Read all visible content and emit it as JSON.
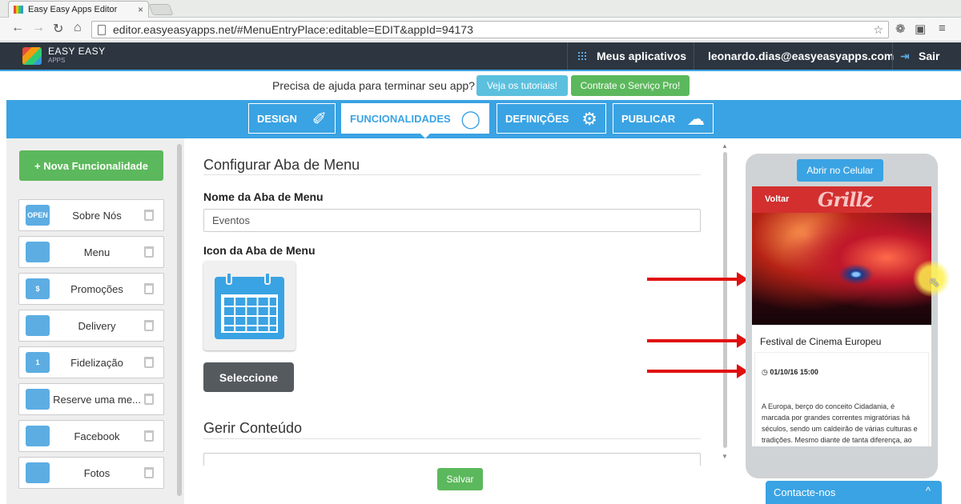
{
  "browser": {
    "tab_title": "Easy Easy Apps Editor",
    "tab_close": "×",
    "url": "editor.easyeasyapps.net/#MenuEntryPlace:editable=EDIT&appId=94173"
  },
  "header": {
    "brand_name": "EASY EASY",
    "brand_sub": "APPS",
    "my_apps": "Meus aplicativos",
    "user_email": "leonardo.dias@easyeasyapps.com",
    "logout": "Sair"
  },
  "help": {
    "text": "Precisa de ajuda para terminar seu app?",
    "tutorials_button": "Veja os tutoriais!",
    "pro_button": "Contrate o Serviço Pro!"
  },
  "nav": {
    "tabs": [
      {
        "label": "DESIGN",
        "icon": "brush-icon"
      },
      {
        "label": "FUNCIONALIDADES",
        "icon": "tags-icon"
      },
      {
        "label": "DEFINIÇÕES",
        "icon": "gear-icon"
      },
      {
        "label": "PUBLICAR",
        "icon": "cloud-upload-icon"
      }
    ],
    "active": "FUNCIONALIDADES"
  },
  "sidebar": {
    "new_button": "+ Nova Funcionalidade",
    "items": [
      {
        "label": "Sobre Nós",
        "icon": "open-sign-icon",
        "icon_text": "OPEN"
      },
      {
        "label": "Menu",
        "icon": "book-icon",
        "icon_text": ""
      },
      {
        "label": "Promoções",
        "icon": "coupon-icon",
        "icon_text": "$"
      },
      {
        "label": "Delivery",
        "icon": "clipboard-icon",
        "icon_text": ""
      },
      {
        "label": "Fidelização",
        "icon": "medal-icon",
        "icon_text": "1"
      },
      {
        "label": "Reserve uma me...",
        "icon": "calendar-icon",
        "icon_text": ""
      },
      {
        "label": "Facebook",
        "icon": "share-icon",
        "icon_text": ""
      },
      {
        "label": "Fotos",
        "icon": "photo-icon",
        "icon_text": ""
      }
    ]
  },
  "editor": {
    "section_title": "Configurar Aba de Menu",
    "name_label": "Nome da Aba de Menu",
    "name_value": "Eventos",
    "icon_label": "Icon da Aba de Menu",
    "select_button": "Seleccione",
    "content_title": "Gerir Conteúdo",
    "save_button": "Salvar"
  },
  "preview": {
    "open_button": "Abrir no Celular",
    "back": "Voltar",
    "logo": "Grillz",
    "event_title": "Festival de Cinema Europeu",
    "event_date": "01/10/16 15:00",
    "event_description": "A Europa, berço do conceito Cidadania, é marcada por grandes correntes migratórias há séculos, sendo um caldeirão de várias culturas e tradições. Mesmo diante de tanta diferença, ao longo dos anos, o"
  },
  "contact": {
    "label": "Contacte-nos",
    "chevron": "^"
  },
  "colors": {
    "primary": "#3aa3e3",
    "success": "#5cb85c",
    "info": "#5bc0de",
    "header_dark": "#2c3540",
    "phone_header": "#d32f2f",
    "annotation_arrow": "#e01010"
  }
}
